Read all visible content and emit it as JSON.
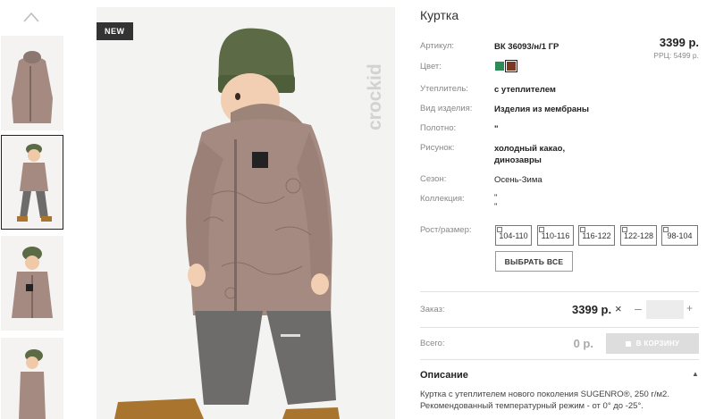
{
  "product": {
    "title": "Куртка",
    "badge": "NEW",
    "brand": "crockid",
    "price": "3399 р.",
    "rrp": "РРЦ: 5499 р."
  },
  "specs": {
    "article_label": "Артикул:",
    "article_value": "ВК 36093/н/1 ГР",
    "color_label": "Цвет:",
    "colors": [
      "#2e8b57",
      "#7a3a22"
    ],
    "insulation_label": "Утеплитель:",
    "insulation_value": "с утеплителем",
    "type_label": "Вид изделия:",
    "type_value": "Изделия из мембраны",
    "fabric_label": "Полотно:",
    "fabric_value": "\"",
    "pattern_label": "Рисунок:",
    "pattern_line1": "холодный какао,",
    "pattern_line2": "динозавры",
    "season_label": "Сезон:",
    "season_value": "Осень-Зима",
    "collection_label": "Коллекция:",
    "collection_line1": "\"",
    "collection_line2": "\""
  },
  "sizes": {
    "label": "Рост/размер:",
    "options": [
      "104-110",
      "110-116",
      "116-122",
      "122-128",
      "98-104"
    ],
    "select_all": "ВЫБРАТЬ ВСЕ"
  },
  "order": {
    "label": "Заказ:",
    "price": "3399 р.",
    "remove_symbol": "×",
    "minus": "–",
    "plus": "+",
    "quantity": ""
  },
  "total": {
    "label": "Всего:",
    "value": "0 р.",
    "cart_button": "В КОРЗИНУ"
  },
  "description": {
    "title": "Описание",
    "toggle": "▲",
    "line1": "Куртка с утеплителем нового поколения SUGENRO®, 250 г/м2.",
    "line2": "Рекомендованный температурный режим - от 0° до -25°."
  }
}
